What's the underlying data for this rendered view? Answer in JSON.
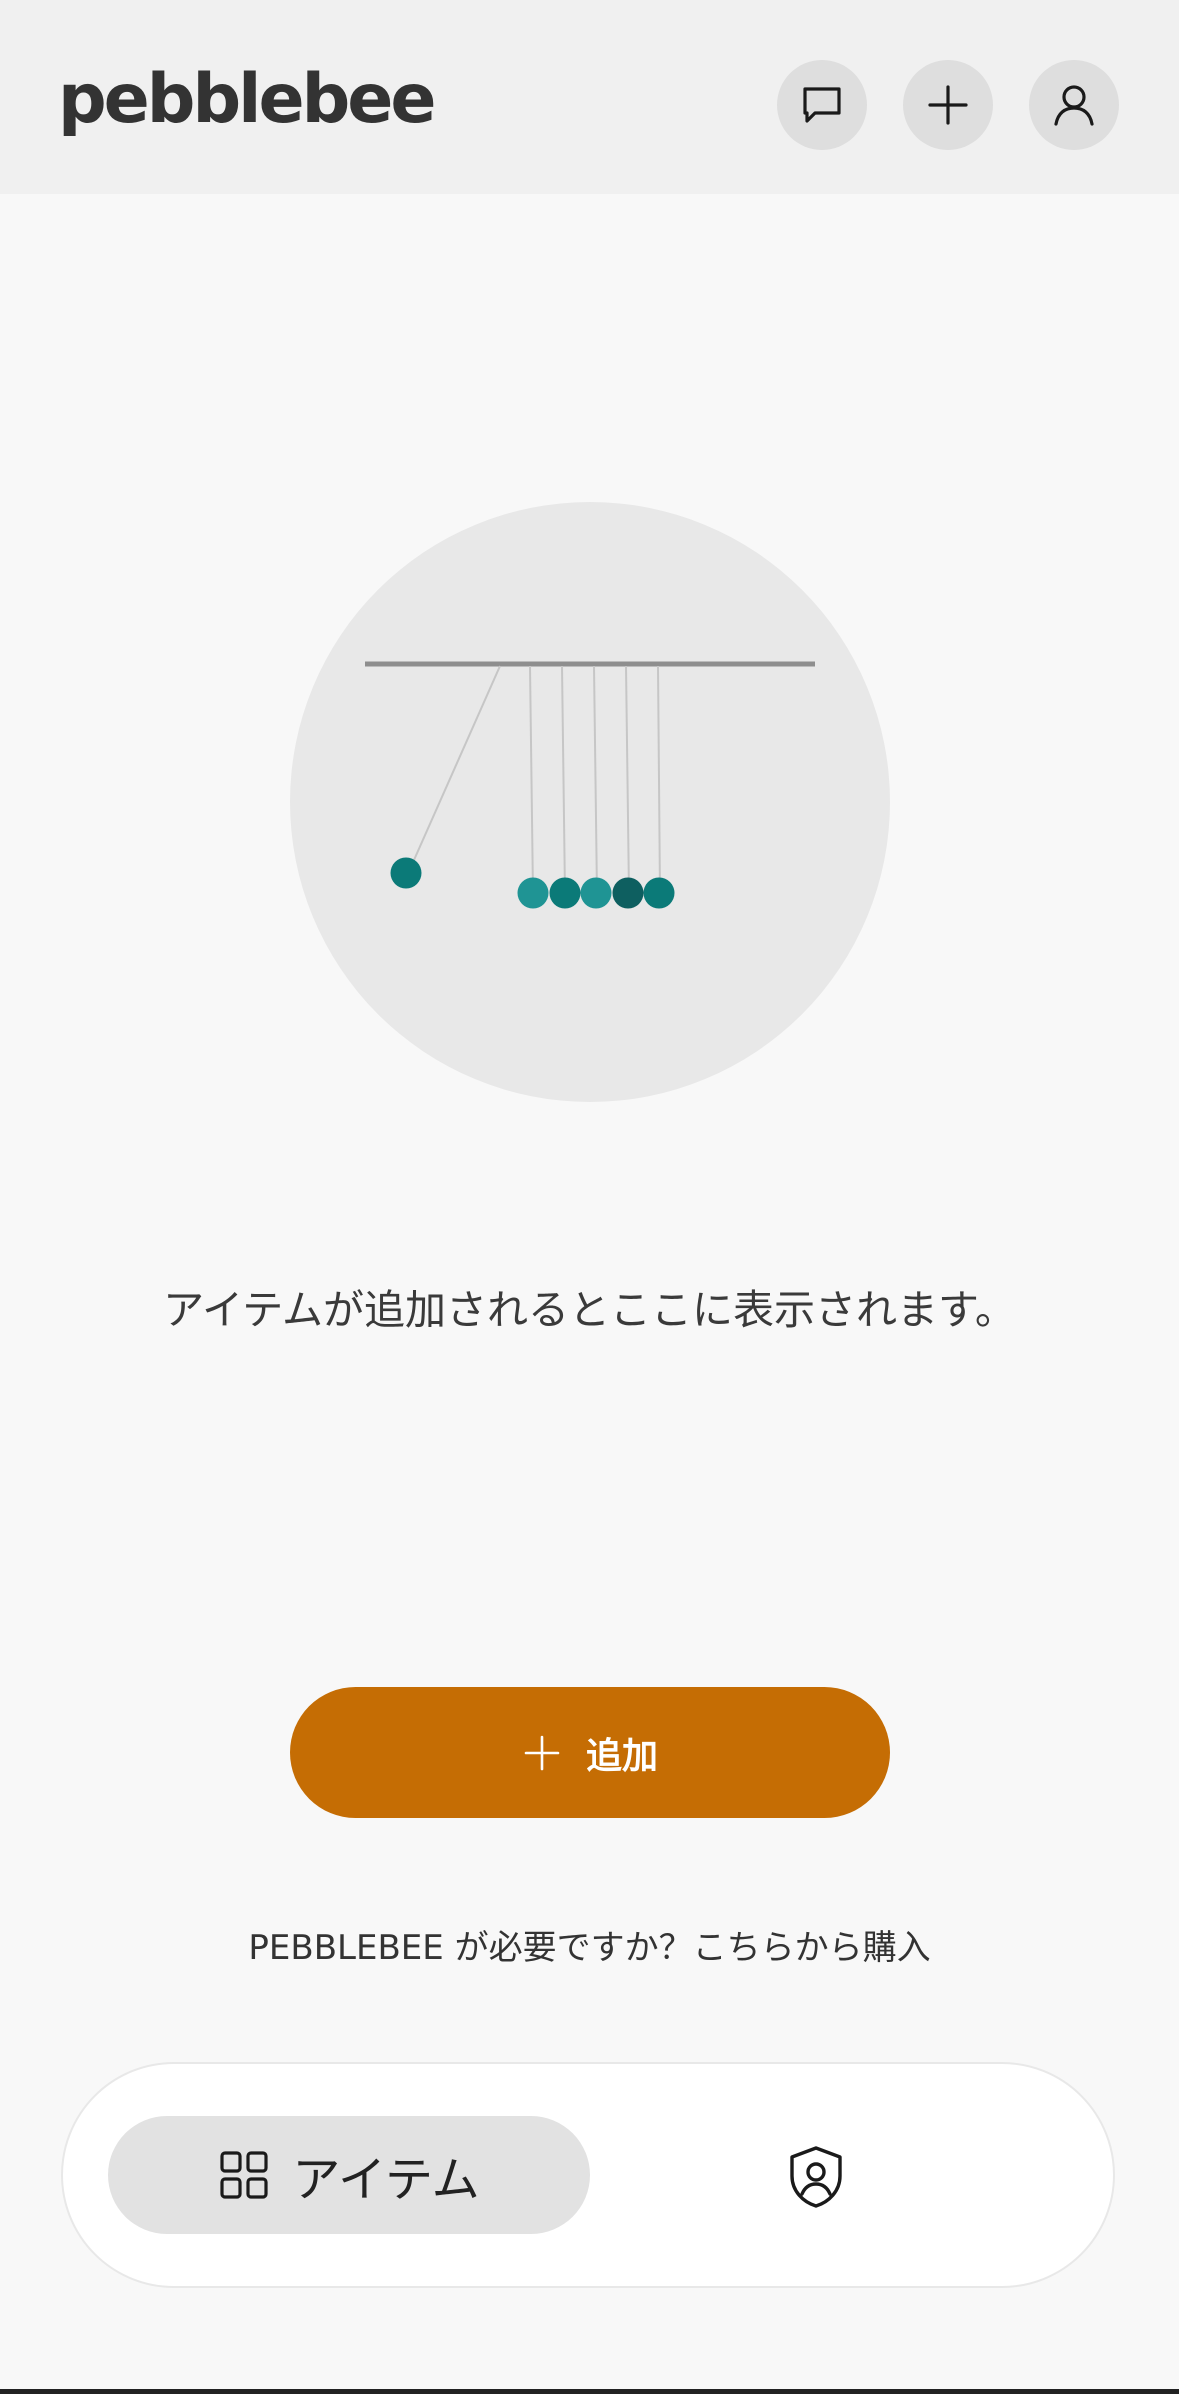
{
  "header": {
    "logo_text": "pebblebee",
    "icons": [
      "chat-icon",
      "plus-icon",
      "user-icon"
    ]
  },
  "main": {
    "empty_message": "アイテムが追加されるとここに表示されます。",
    "add_button_label": "追加",
    "buy_link_text": "PEBBLEBEE が必要ですか？こちらから購入"
  },
  "bottom_nav": {
    "items_tab_label": "アイテム",
    "icons": [
      "grid-icon",
      "shield-user-icon"
    ]
  },
  "colors": {
    "accent": "#c56d04",
    "pendulum_teal": "#0b7a78",
    "pendulum_light_teal": "#1f9494",
    "pendulum_dark_teal": "#0e5f60"
  }
}
